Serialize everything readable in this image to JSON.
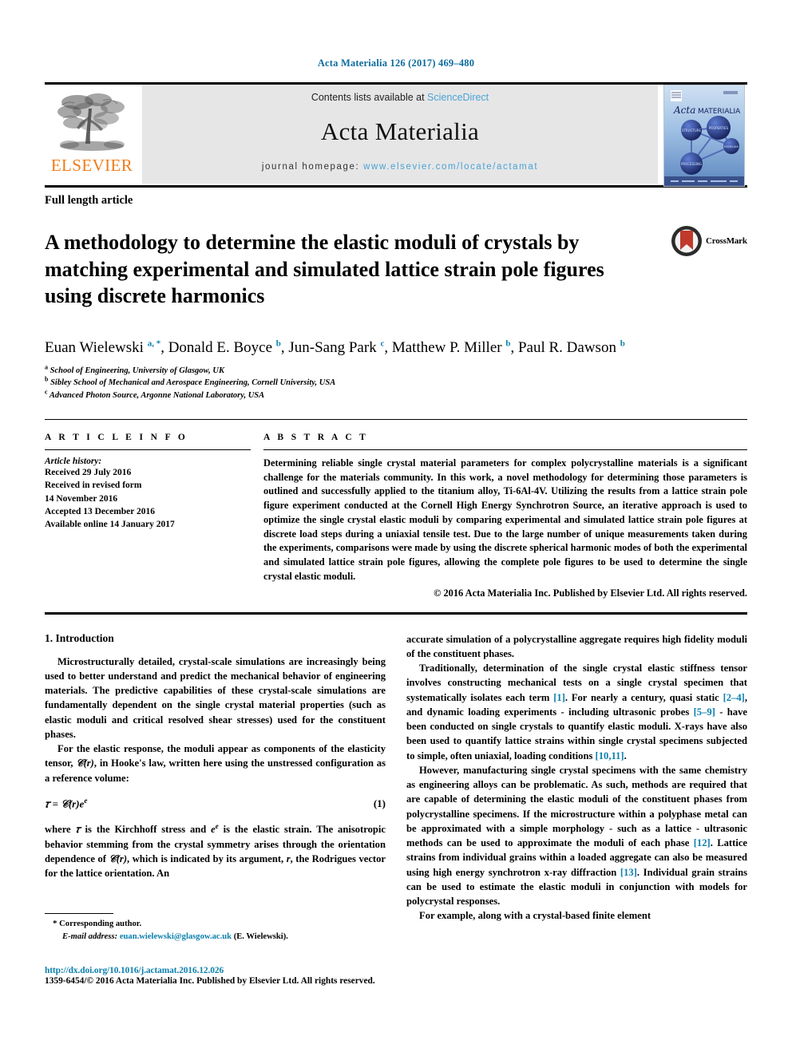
{
  "running_head": "Acta Materialia 126 (2017) 469–480",
  "masthead": {
    "publisher_name": "ELSEVIER",
    "contents_prefix": "Contents lists available at ",
    "contents_link": "ScienceDirect",
    "journal_title": "Acta Materialia",
    "homepage_prefix": "journal homepage: ",
    "homepage_url": "www.elsevier.com/locate/actamat",
    "cover_title_italic": "Acta",
    "cover_title_rest": "MATERIALIA",
    "cover_nodes": [
      "STRUCTURE",
      "PROPERTIES",
      "MODELING",
      "PROCESSING"
    ]
  },
  "article": {
    "type": "Full length article",
    "title": "A methodology to determine the elastic moduli of crystals by matching experimental and simulated lattice strain pole figures using discrete harmonics",
    "crossmark_label": "CrossMark",
    "authors_html": "Euan Wielewski <sup>a, *</sup>, Donald E. Boyce <sup>b</sup>, Jun-Sang Park <sup>c</sup>, Matthew P. Miller <sup>b</sup>, Paul R. Dawson <sup>b</sup>",
    "affiliations": [
      {
        "mark": "a",
        "text": "School of Engineering, University of Glasgow, UK"
      },
      {
        "mark": "b",
        "text": "Sibley School of Mechanical and Aerospace Engineering, Cornell University, USA"
      },
      {
        "mark": "c",
        "text": "Advanced Photon Source, Argonne National Laboratory, USA"
      }
    ]
  },
  "info": {
    "heading": "A R T I C L E   I N F O",
    "history_label": "Article history:",
    "history": [
      "Received 29 July 2016",
      "Received in revised form",
      "14 November 2016",
      "Accepted 13 December 2016",
      "Available online 14 January 2017"
    ]
  },
  "abstract": {
    "heading": "A B S T R A C T",
    "text": "Determining reliable single crystal material parameters for complex polycrystalline materials is a significant challenge for the materials community. In this work, a novel methodology for determining those parameters is outlined and successfully applied to the titanium alloy, Ti-6Al-4V. Utilizing the results from a lattice strain pole figure experiment conducted at the Cornell High Energy Synchrotron Source, an iterative approach is used to optimize the single crystal elastic moduli by comparing experimental and simulated lattice strain pole figures at discrete load steps during a uniaxial tensile test. Due to the large number of unique measurements taken during the experiments, comparisons were made by using the discrete spherical harmonic modes of both the experimental and simulated lattice strain pole figures, allowing the complete pole figures to be used to determine the single crystal elastic moduli.",
    "copyright": "© 2016 Acta Materialia Inc. Published by Elsevier Ltd. All rights reserved."
  },
  "body": {
    "section_number_title": "1. Introduction",
    "left_p1": "Microstructurally detailed, crystal-scale simulations are increasingly being used to better understand and predict the mechanical behavior of engineering materials. The predictive capabilities of these crystal-scale simulations are fundamentally dependent on the single crystal material properties (such as elastic moduli and critical resolved shear stresses) used for the constituent phases.",
    "left_p2_part1": "For the elastic response, the moduli appear as components of the elasticity tensor, ",
    "left_p2_part2": ", in Hooke's law, written here using the unstressed configuration as a reference volume:",
    "equation_number": "(1)",
    "left_p3_part1": "where ",
    "left_p3_part2": " is the Kirchhoff stress and ",
    "left_p3_part3": " is the elastic strain. The anisotropic behavior stemming from the crystal symmetry arises through the orientation dependence of ",
    "left_p3_part4": ", which is indicated by its argument, ",
    "left_p3_part5": ", the Rodrigues vector for the lattice orientation. An",
    "right_p1": "accurate simulation of a polycrystalline aggregate requires high fidelity moduli of the constituent phases.",
    "right_p2_a": "Traditionally, determination of the single crystal elastic stiffness tensor involves constructing mechanical tests on a single crystal specimen that systematically isolates each term ",
    "right_p2_ref1": "[1]",
    "right_p2_b": ". For nearly a century, quasi static ",
    "right_p2_ref2": "[2–4]",
    "right_p2_c": ", and dynamic loading experiments - including ultrasonic probes ",
    "right_p2_ref3": "[5–9]",
    "right_p2_d": " - have been conducted on single crystals to quantify elastic moduli. X-rays have also been used to quantify lattice strains within single crystal specimens subjected to simple, often uniaxial, loading conditions ",
    "right_p2_ref4": "[10,11]",
    "right_p2_e": ".",
    "right_p3_a": "However, manufacturing single crystal specimens with the same chemistry as engineering alloys can be problematic. As such, methods are required that are capable of determining the elastic moduli of the constituent phases from polycrystalline specimens. If the microstructure within a polyphase metal can be approximated with a simple morphology - such as a lattice - ultrasonic methods can be used to approximate the moduli of each phase ",
    "right_p3_ref1": "[12]",
    "right_p3_b": ". Lattice strains from individual grains within a loaded aggregate can also be measured using high energy synchrotron x-ray diffraction ",
    "right_p3_ref2": "[13]",
    "right_p3_c": ". Individual grain strains can be used to estimate the elastic moduli in conjunction with models for polycrystal responses.",
    "right_p4": "For example, along with a crystal-based finite element"
  },
  "footnote": {
    "star": "*",
    "corresponding": " Corresponding author.",
    "email_label": "E-mail address:",
    "email": "euan.wielewski@glasgow.ac.uk",
    "email_owner": "(E. Wielewski)."
  },
  "footer": {
    "doi": "http://dx.doi.org/10.1016/j.actamat.2016.12.026",
    "issn_line": "1359-6454/© 2016 Acta Materialia Inc. Published by Elsevier Ltd. All rights reserved."
  },
  "colors": {
    "link_blue": "#0b7fae",
    "sciencedirect_blue": "#4aa3d6",
    "elsevier_orange": "#f07c1a",
    "band_grey": "#e6e6e6",
    "crossmark_red": "#c0392b"
  }
}
